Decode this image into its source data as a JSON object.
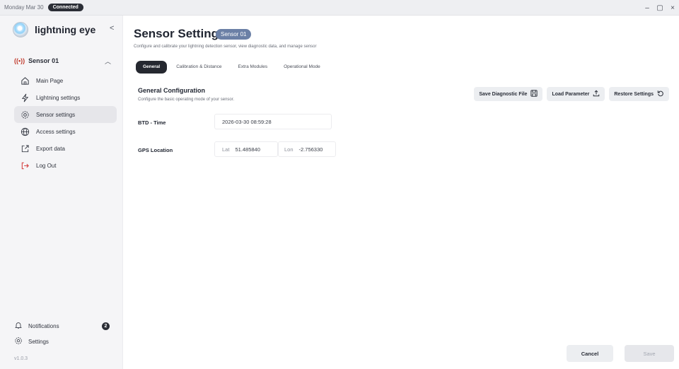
{
  "titlebar": {
    "date": "Monday Mar 30",
    "status": "Connected",
    "controls": [
      "–",
      "▢",
      "×"
    ]
  },
  "brand": {
    "name": "lightning eye"
  },
  "sidebar": {
    "sensor": "Sensor 01",
    "items": [
      {
        "label": "Main Page",
        "icon": "home-icon"
      },
      {
        "label": "Lightning settings",
        "icon": "lightning-icon"
      },
      {
        "label": "Sensor settings",
        "icon": "gear-icon",
        "active": true
      },
      {
        "label": "Access settings",
        "icon": "globe-icon"
      },
      {
        "label": "Export data",
        "icon": "export-icon"
      },
      {
        "label": "Log Out",
        "icon": "logout-icon"
      }
    ],
    "notifications_label": "Notifications",
    "notifications_count": "2",
    "settings_label": "Settings",
    "version": "v1.0.3"
  },
  "header": {
    "title": "Sensor Settings",
    "badge": "Sensor 01",
    "subtitle": "Configure and calibrate your lightning detection sensor, view diagnostic data, and manage sensor"
  },
  "tabs": [
    "General",
    "Calibration & Distance",
    "Extra Modules",
    "Operational Mode"
  ],
  "section": {
    "title": "General Configuration",
    "description": "Configure the basic operating mode of your sensor."
  },
  "actions": {
    "save_diagnostic": "Save Diagnostic File",
    "load_parameter": "Load Parameter",
    "restore_settings": "Restore Settings"
  },
  "fields": {
    "btd_label": "BTD - Time",
    "btd_value": "2026-03-30 08:59:28",
    "gps_label": "GPS Location",
    "lat_label": "Lat",
    "lat_value": "51.485840",
    "lon_label": "Lon",
    "lon_value": "-2.756330"
  },
  "footer": {
    "cancel": "Cancel",
    "save": "Save"
  },
  "colors": {
    "accent": "#6b80a6",
    "dark": "#252830",
    "signal": "#c0392b"
  }
}
